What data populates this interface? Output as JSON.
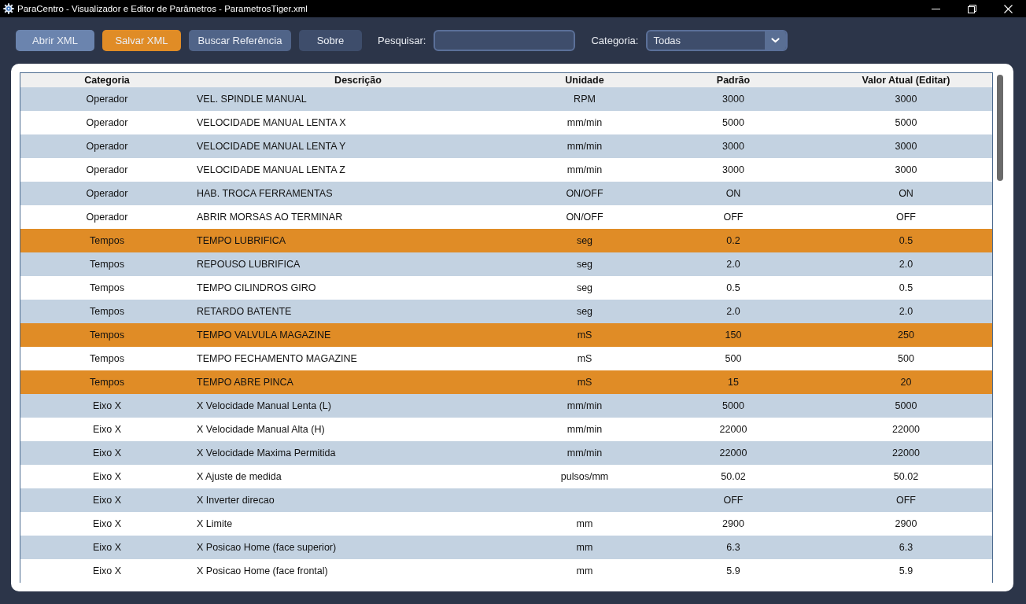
{
  "window": {
    "title": "ParaCentro - Visualizador e Editor de Parâmetros - ParametrosTiger.xml"
  },
  "toolbar": {
    "buttons": [
      {
        "label": "Abrir XML",
        "color": "#6b84ae"
      },
      {
        "label": "Salvar XML",
        "color": "#e08c26"
      },
      {
        "label": "Buscar Referência",
        "color": "#506488"
      },
      {
        "label": "Sobre",
        "color": "#3e4d6b"
      }
    ],
    "search": {
      "label": "Pesquisar:"
    },
    "category": {
      "label": "Categoria:",
      "value": "Todas"
    }
  },
  "table": {
    "columns": [
      "Categoria",
      "Descrição",
      "Unidade",
      "Padrão",
      "Valor Atual (Editar)"
    ],
    "rows": [
      {
        "category": "Operador",
        "description": "VEL. SPINDLE MANUAL",
        "unit": "RPM",
        "default": "3000",
        "current": "3000",
        "color": "#c3d2e1"
      },
      {
        "category": "Operador",
        "description": "VELOCIDADE MANUAL LENTA X",
        "unit": "mm/min",
        "default": "5000",
        "current": "5000",
        "color": "#ffffff"
      },
      {
        "category": "Operador",
        "description": "VELOCIDADE MANUAL LENTA Y",
        "unit": "mm/min",
        "default": "3000",
        "current": "3000",
        "color": "#c3d2e1"
      },
      {
        "category": "Operador",
        "description": "VELOCIDADE MANUAL LENTA Z",
        "unit": "mm/min",
        "default": "3000",
        "current": "3000",
        "color": "#ffffff"
      },
      {
        "category": "Operador",
        "description": "HAB. TROCA FERRAMENTAS",
        "unit": "ON/OFF",
        "default": "ON",
        "current": "ON",
        "color": "#c3d2e1"
      },
      {
        "category": "Operador",
        "description": "ABRIR MORSAS AO TERMINAR",
        "unit": "ON/OFF",
        "default": "OFF",
        "current": "OFF",
        "color": "#ffffff"
      },
      {
        "category": "Tempos",
        "description": "TEMPO LUBRIFICA",
        "unit": "seg",
        "default": "0.2",
        "current": "0.5",
        "color": "#e08c26"
      },
      {
        "category": "Tempos",
        "description": "REPOUSO LUBRIFICA",
        "unit": "seg",
        "default": "2.0",
        "current": "2.0",
        "color": "#c3d2e1"
      },
      {
        "category": "Tempos",
        "description": "TEMPO CILINDROS GIRO",
        "unit": "seg",
        "default": "0.5",
        "current": "0.5",
        "color": "#ffffff"
      },
      {
        "category": "Tempos",
        "description": "RETARDO BATENTE",
        "unit": "seg",
        "default": "2.0",
        "current": "2.0",
        "color": "#c3d2e1"
      },
      {
        "category": "Tempos",
        "description": "TEMPO VALVULA MAGAZINE",
        "unit": "mS",
        "default": "150",
        "current": "250",
        "color": "#e08c26"
      },
      {
        "category": "Tempos",
        "description": "TEMPO FECHAMENTO MAGAZINE",
        "unit": "mS",
        "default": "500",
        "current": "500",
        "color": "#ffffff"
      },
      {
        "category": "Tempos",
        "description": "TEMPO ABRE PINCA",
        "unit": "mS",
        "default": "15",
        "current": "20",
        "color": "#e08c26"
      },
      {
        "category": "Eixo X",
        "description": "X Velocidade Manual Lenta (L)",
        "unit": "mm/min",
        "default": "5000",
        "current": "5000",
        "color": "#c3d2e1"
      },
      {
        "category": "Eixo X",
        "description": "X Velocidade Manual Alta (H)",
        "unit": "mm/min",
        "default": "22000",
        "current": "22000",
        "color": "#ffffff"
      },
      {
        "category": "Eixo X",
        "description": "X Velocidade Maxima Permitida",
        "unit": "mm/min",
        "default": "22000",
        "current": "22000",
        "color": "#c3d2e1"
      },
      {
        "category": "Eixo X",
        "description": "X Ajuste de medida",
        "unit": "pulsos/mm",
        "default": "50.02",
        "current": "50.02",
        "color": "#ffffff"
      },
      {
        "category": "Eixo X",
        "description": "X Inverter direcao",
        "default": "OFF",
        "current": "OFF",
        "color": "#c3d2e1"
      },
      {
        "category": "Eixo X",
        "description": "X Limite",
        "unit": "mm",
        "default": "2900",
        "current": "2900",
        "color": "#ffffff"
      },
      {
        "category": "Eixo X",
        "description": "X Posicao Home (face superior)",
        "unit": "mm",
        "default": "6.3",
        "current": "6.3",
        "color": "#c3d2e1"
      },
      {
        "category": "Eixo X",
        "description": "X Posicao Home (face frontal)",
        "unit": "mm",
        "default": "5.9",
        "current": "5.9",
        "color": "#ffffff"
      }
    ]
  }
}
